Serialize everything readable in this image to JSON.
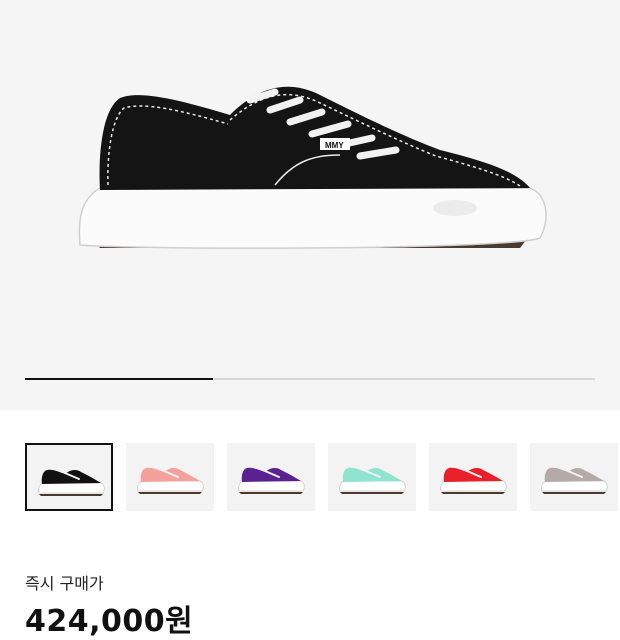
{
  "product": {
    "carousel_progress": 0.33,
    "shoe_brand_tag": "MMY",
    "thumbnails": [
      {
        "color_name": "black",
        "upper_color": "#111111",
        "active": true
      },
      {
        "color_name": "pink",
        "upper_color": "#f3a19a",
        "active": false
      },
      {
        "color_name": "purple",
        "upper_color": "#5a2190",
        "active": false
      },
      {
        "color_name": "mint",
        "upper_color": "#8fe3cf",
        "active": false
      },
      {
        "color_name": "red",
        "upper_color": "#e8202a",
        "active": false
      },
      {
        "color_name": "grey",
        "upper_color": "#b4aaa8",
        "active": false
      }
    ],
    "price_label": "즉시 구매가",
    "price": "424,000원"
  },
  "colors": {
    "hero_bg": "#f5f5f5",
    "sole": "#ffffff",
    "outsole": "#4a3b30"
  }
}
